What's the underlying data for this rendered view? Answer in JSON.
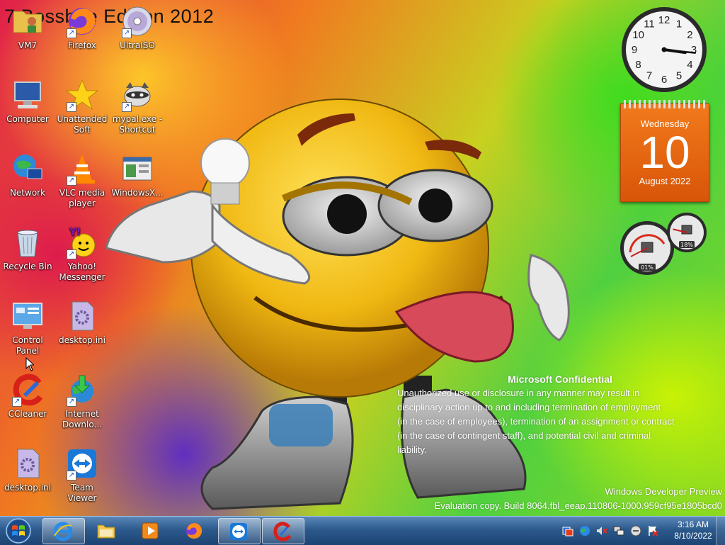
{
  "desktop": {
    "wallpaper_title": "7 Bossboe Edition 2012",
    "icons": [
      {
        "label": "VM7",
        "icon": "folder-person-icon",
        "shortcut": false
      },
      {
        "label": "Firefox",
        "icon": "firefox-icon",
        "shortcut": true
      },
      {
        "label": "UltraISO",
        "icon": "disc-icon",
        "shortcut": true
      },
      {
        "label": "Computer",
        "icon": "computer-icon",
        "shortcut": false
      },
      {
        "label": "Unattended Soft",
        "icon": "star-icon",
        "shortcut": true
      },
      {
        "label": "mypal.exe - Shortcut",
        "icon": "raccoon-icon",
        "shortcut": true
      },
      {
        "label": "Network",
        "icon": "network-icon",
        "shortcut": false
      },
      {
        "label": "VLC media player",
        "icon": "vlc-cone-icon",
        "shortcut": true
      },
      {
        "label": "WindowsX...",
        "icon": "window-app-icon",
        "shortcut": false
      },
      {
        "label": "Recycle Bin",
        "icon": "recycle-bin-icon",
        "shortcut": false
      },
      {
        "label": "Yahoo! Messenger",
        "icon": "yahoo-messenger-icon",
        "shortcut": true
      },
      {
        "label": "Control Panel",
        "icon": "control-panel-icon",
        "shortcut": false
      },
      {
        "label": "desktop.ini",
        "icon": "settings-file-icon",
        "shortcut": false
      },
      {
        "label": "CCleaner",
        "icon": "ccleaner-icon",
        "shortcut": true
      },
      {
        "label": "Internet Downlo...",
        "icon": "download-globe-icon",
        "shortcut": true
      },
      {
        "label": "desktop.ini",
        "icon": "settings-file-icon",
        "shortcut": false
      },
      {
        "label": "Team Viewer",
        "icon": "teamviewer-icon",
        "shortcut": true
      }
    ]
  },
  "gadgets": {
    "clock": {
      "hour": 3,
      "minute": 16,
      "numbers": [
        "12",
        "1",
        "2",
        "3",
        "4",
        "5",
        "6",
        "7",
        "8",
        "9",
        "10",
        "11"
      ]
    },
    "calendar": {
      "weekday": "Wednesday",
      "day": "10",
      "month_year": "August 2022"
    },
    "meter": {
      "cpu_percent": 1,
      "cpu_label": "01%",
      "memory_percent": 18,
      "memory_label": "18%"
    }
  },
  "watermark": {
    "confidential_title": "Microsoft Confidential",
    "confidential_lines": [
      "Unauthorized use or disclosure in any manner may result in",
      "disciplinary action up to and including termination of employment",
      "(in the case of employees), termination of an assignment or contract",
      "(in the case of contingent staff), and potential civil and criminal",
      "liability."
    ],
    "edition": "Windows Developer Preview",
    "build": "Evaluation copy. Build 8064.fbl_eeap.110806-1000.959cf95e1805bcd0"
  },
  "taskbar": {
    "buttons": [
      {
        "name": "internet-explorer",
        "icon": "internet-explorer-icon",
        "active": true
      },
      {
        "name": "explorer",
        "icon": "folder-icon",
        "active": false
      },
      {
        "name": "media-player",
        "icon": "media-player-icon",
        "active": false
      },
      {
        "name": "firefox",
        "icon": "firefox-icon",
        "active": false
      },
      {
        "name": "teamviewer",
        "icon": "teamviewer-icon",
        "active": true
      },
      {
        "name": "ccleaner",
        "icon": "ccleaner-icon",
        "active": true
      }
    ],
    "tray": {
      "icons": [
        "security-shield-icon",
        "network-globe-icon",
        "volume-muted-icon",
        "network-status-icon",
        "minus-circle-icon",
        "action-center-flag-icon"
      ],
      "time": "3:16 AM",
      "date": "8/10/2022"
    }
  },
  "colors": {
    "calendar": "#e8650f",
    "taskbar": "#2c5a8d",
    "smiley": "#f2c21a"
  }
}
